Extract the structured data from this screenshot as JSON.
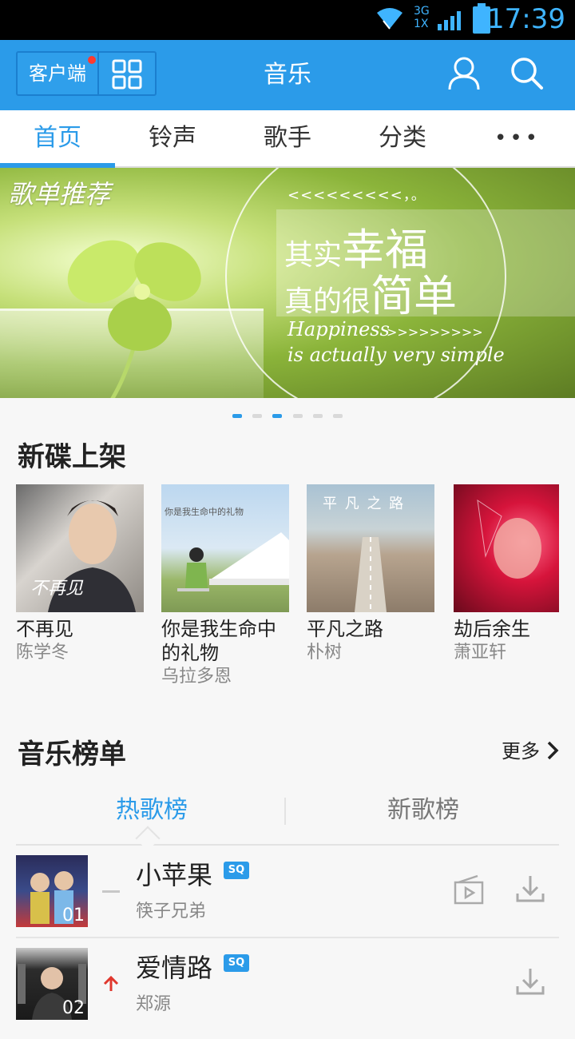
{
  "status_bar": {
    "time": "17:39",
    "network_top": "3G",
    "network_bottom": "1X"
  },
  "header": {
    "client_label": "客户端",
    "title": "音乐"
  },
  "tabs": [
    {
      "label": "首页",
      "active": true
    },
    {
      "label": "铃声",
      "active": false
    },
    {
      "label": "歌手",
      "active": false
    },
    {
      "label": "分类",
      "active": false
    },
    {
      "label": "•••",
      "active": false
    }
  ],
  "banner": {
    "tag": "歌单推荐",
    "arrows_top": "<<<<<<<<<，。",
    "line1_small": "其实",
    "line1_big": "幸福",
    "line2_small": "真的很",
    "line2_big": "简单",
    "english_1": "Happiness",
    "arrows_bottom": ">>>>>>>>>",
    "english_2": "is actually very simple",
    "page_count": 6,
    "active_page": 3
  },
  "new_albums": {
    "title": "新碟上架",
    "items": [
      {
        "name": "不再见",
        "artist": "陈学冬",
        "cover_text": "不再见"
      },
      {
        "name": "你是我生命中的礼物",
        "artist": "乌拉多恩",
        "cover_text": "你是我生命中的礼物"
      },
      {
        "name": "平凡之路",
        "artist": "朴树",
        "cover_text": "平 凡 之 路"
      },
      {
        "name": "劫后余生",
        "artist": "萧亚轩",
        "cover_text": ""
      }
    ]
  },
  "charts": {
    "title": "音乐榜单",
    "more_label": "更多",
    "tabs": [
      {
        "label": "热歌榜",
        "active": true
      },
      {
        "label": "新歌榜",
        "active": false
      }
    ],
    "songs": [
      {
        "rank": "01",
        "title": "小苹果",
        "artist": "筷子兄弟",
        "quality": "SQ",
        "trend": "same",
        "has_mv": true
      },
      {
        "rank": "02",
        "title": "爱情路",
        "artist": "郑源",
        "quality": "SQ",
        "trend": "up",
        "has_mv": false
      }
    ]
  },
  "colors": {
    "accent": "#2b9be9",
    "status_text": "#3fb4ff",
    "trend_up": "#e0382e"
  }
}
